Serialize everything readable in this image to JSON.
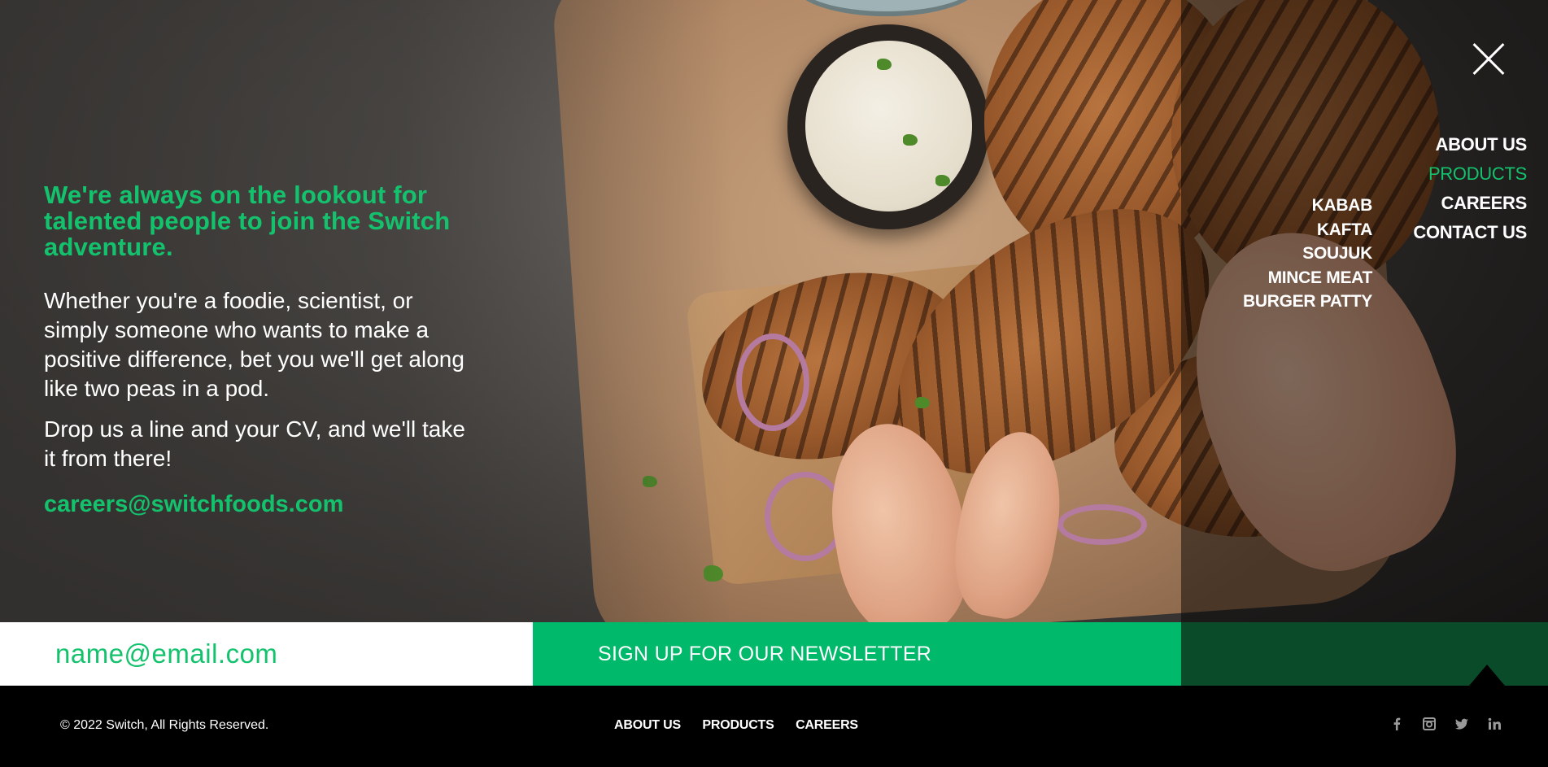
{
  "hero": {
    "headline": "We're always on the lookout for talented people to join the Switch adventure.",
    "paragraph1": "Whether you're a foodie, scientist, or simply someone who wants to make a positive difference, bet you we'll get along like two peas in a pod.",
    "paragraph2": "Drop us a line and your CV, and we'll take it from there!",
    "email": "careers@switchfoods.com"
  },
  "menu": {
    "close_icon": "close-icon",
    "main_items": [
      {
        "label": "ABOUT US",
        "active": false
      },
      {
        "label": "PRODUCTS",
        "active": true
      },
      {
        "label": "CAREERS",
        "active": false
      },
      {
        "label": "CONTACT US",
        "active": false
      }
    ],
    "sub_items": [
      {
        "label": "KABAB"
      },
      {
        "label": "KAFTA"
      },
      {
        "label": "SOUJUK"
      },
      {
        "label": "MINCE MEAT"
      },
      {
        "label": "BURGER PATTY"
      }
    ]
  },
  "newsletter": {
    "placeholder": "name@email.com",
    "button_label": "SIGN UP FOR OUR NEWSLETTER"
  },
  "footer": {
    "copyright": "© 2022 Switch, All Rights Reserved.",
    "nav": [
      {
        "label": "ABOUT US"
      },
      {
        "label": "PRODUCTS"
      },
      {
        "label": "CAREERS"
      }
    ],
    "social_icons": [
      "facebook-icon",
      "instagram-icon",
      "twitter-icon",
      "linkedin-icon"
    ]
  },
  "colors": {
    "accent": "#14c26d",
    "button_green": "#00b96a",
    "dark_green": "#0a4b2a"
  }
}
